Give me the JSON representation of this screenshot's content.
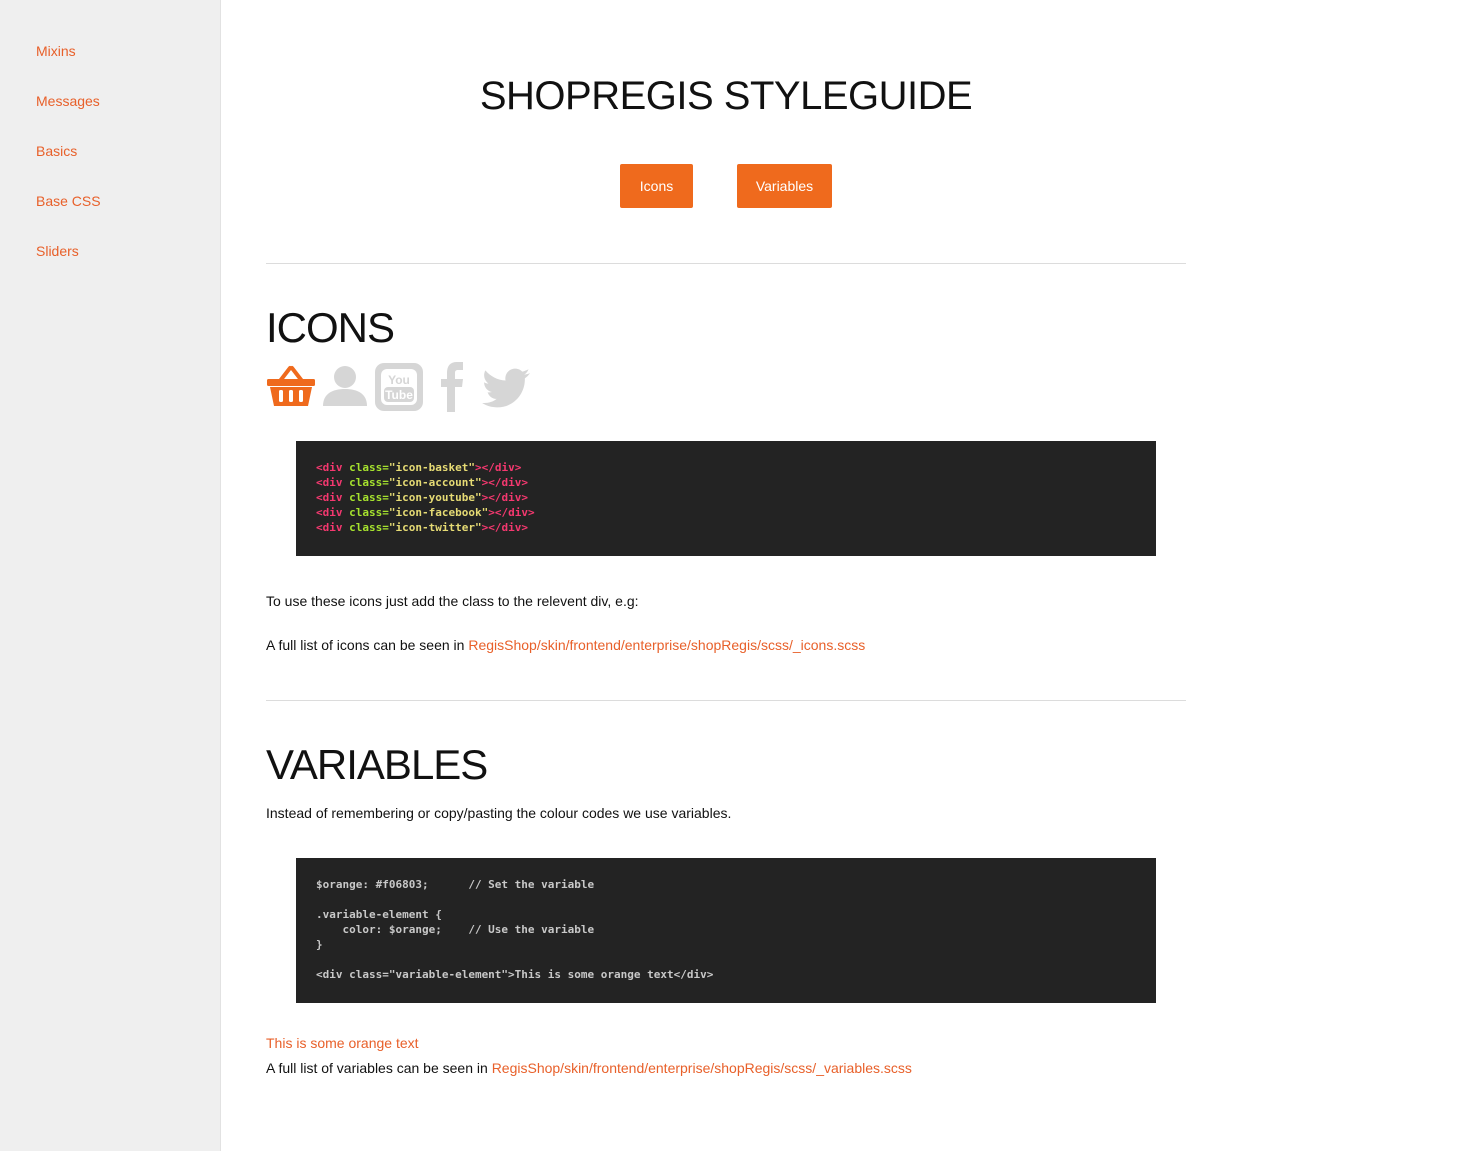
{
  "sidebar": {
    "items": [
      {
        "label": "Mixins"
      },
      {
        "label": "Messages"
      },
      {
        "label": "Basics"
      },
      {
        "label": "Base CSS"
      },
      {
        "label": "Sliders"
      }
    ]
  },
  "header": {
    "title": "SHOPREGIS STYLEGUIDE",
    "buttons": [
      {
        "label": "Icons"
      },
      {
        "label": "Variables"
      }
    ]
  },
  "icons_section": {
    "title": "ICONS",
    "icons": [
      "basket-icon",
      "account-icon",
      "youtube-icon",
      "facebook-icon",
      "twitter-icon"
    ],
    "icon_colors": {
      "active": "#ef6a1d",
      "inactive": "#d6d6d6"
    },
    "code_lines": [
      {
        "open": "<div ",
        "attr": "class=",
        "value": "\"icon-basket\"",
        "close": "></div>"
      },
      {
        "open": "<div ",
        "attr": "class=",
        "value": "\"icon-account\"",
        "close": "></div>"
      },
      {
        "open": "<div ",
        "attr": "class=",
        "value": "\"icon-youtube\"",
        "close": "></div>"
      },
      {
        "open": "<div ",
        "attr": "class=",
        "value": "\"icon-facebook\"",
        "close": "></div>"
      },
      {
        "open": "<div ",
        "attr": "class=",
        "value": "\"icon-twitter\"",
        "close": "></div>"
      }
    ],
    "usage_text": "To use these icons just add the class to the relevent div, e.g:",
    "full_list_prefix": "A full list of icons can be seen in ",
    "full_list_link": "RegisShop/skin/frontend/enterprise/shopRegis/scss/_icons.scss"
  },
  "variables_section": {
    "title": "VARIABLES",
    "intro": "Instead of remembering or copy/pasting the colour codes we use variables.",
    "code_lines": [
      "$orange: #f06803;      // Set the variable",
      "",
      ".variable-element {",
      "    color: $orange;    // Use the variable",
      "}",
      "",
      "<div class=\"variable-element\">This is some orange text</div>"
    ],
    "sample_text": "This is some orange text",
    "full_list_prefix": "A full list of variables can be seen in ",
    "full_list_link": "RegisShop/skin/frontend/enterprise/shopRegis/scss/_variables.scss"
  },
  "colors": {
    "accent": "#ef6a1d",
    "link": "#e8602a",
    "code_bg": "#232323",
    "sidebar_bg": "#efefef"
  }
}
